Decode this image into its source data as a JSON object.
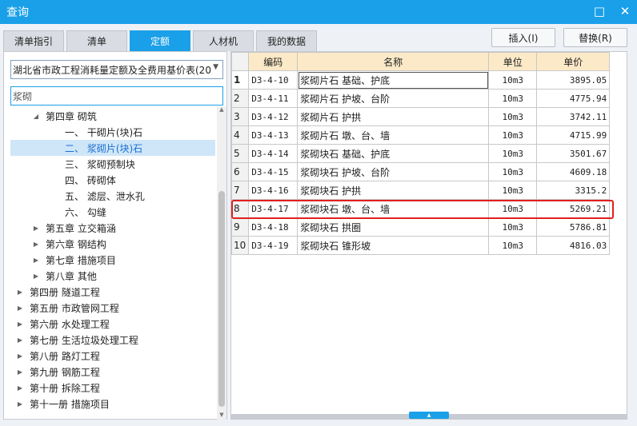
{
  "window": {
    "title": "查询",
    "minimize_glyph": "□",
    "close_glyph": "✕"
  },
  "tabs": [
    {
      "label": "清单指引"
    },
    {
      "label": "清单"
    },
    {
      "label": "定额"
    },
    {
      "label": "人材机"
    },
    {
      "label": "我的数据"
    }
  ],
  "active_tab": "定额",
  "buttons": {
    "insert": "插入(I)",
    "replace": "替换(R)"
  },
  "library": {
    "selected": "湖北省市政工程消耗量定额及全费用基价表(20"
  },
  "search": {
    "value": "浆砌"
  },
  "tree": [
    {
      "label": "第四章 砌筑",
      "level": 1,
      "expanded": true
    },
    {
      "label": "一、 干砌片(块)石",
      "level": 2
    },
    {
      "label": "二、 浆砌片(块)石",
      "level": 2,
      "selected": true
    },
    {
      "label": "三、 浆砌预制块",
      "level": 2
    },
    {
      "label": "四、 砖砌体",
      "level": 2
    },
    {
      "label": "五、 滤层、泄水孔",
      "level": 2
    },
    {
      "label": "六、 勾缝",
      "level": 2
    },
    {
      "label": "第五章 立交箱涵",
      "level": 1
    },
    {
      "label": "第六章 钢结构",
      "level": 1
    },
    {
      "label": "第七章 措施项目",
      "level": 1
    },
    {
      "label": "第八章 其他",
      "level": 1
    },
    {
      "label": "第四册 隧道工程",
      "level": 0
    },
    {
      "label": "第五册 市政管网工程",
      "level": 0
    },
    {
      "label": "第六册 水处理工程",
      "level": 0
    },
    {
      "label": "第七册 生活垃圾处理工程",
      "level": 0
    },
    {
      "label": "第八册 路灯工程",
      "level": 0
    },
    {
      "label": "第九册 钢筋工程",
      "level": 0
    },
    {
      "label": "第十册 拆除工程",
      "level": 0
    },
    {
      "label": "第十一册 措施项目",
      "level": 0
    }
  ],
  "table": {
    "headers": {
      "code": "编码",
      "name": "名称",
      "unit": "单位",
      "price": "单价"
    },
    "rows": [
      {
        "idx": "1",
        "code": "D3-4-10",
        "name": "浆砌片石 基础、护底",
        "unit": "10m3",
        "price": "3895.05"
      },
      {
        "idx": "2",
        "code": "D3-4-11",
        "name": "浆砌片石 护坡、台阶",
        "unit": "10m3",
        "price": "4775.94"
      },
      {
        "idx": "3",
        "code": "D3-4-12",
        "name": "浆砌片石 护拱",
        "unit": "10m3",
        "price": "3742.11"
      },
      {
        "idx": "4",
        "code": "D3-4-13",
        "name": "浆砌片石 墩、台、墙",
        "unit": "10m3",
        "price": "4715.99"
      },
      {
        "idx": "5",
        "code": "D3-4-14",
        "name": "浆砌块石 基础、护底",
        "unit": "10m3",
        "price": "3501.67"
      },
      {
        "idx": "6",
        "code": "D3-4-15",
        "name": "浆砌块石 护坡、台阶",
        "unit": "10m3",
        "price": "4609.18"
      },
      {
        "idx": "7",
        "code": "D3-4-16",
        "name": "浆砌块石 护拱",
        "unit": "10m3",
        "price": "3315.2"
      },
      {
        "idx": "8",
        "code": "D3-4-17",
        "name": "浆砌块石 墩、台、墙",
        "unit": "10m3",
        "price": "5269.21"
      },
      {
        "idx": "9",
        "code": "D3-4-18",
        "name": "浆砌块石 拱圈",
        "unit": "10m3",
        "price": "5786.81"
      },
      {
        "idx": "10",
        "code": "D3-4-19",
        "name": "浆砌块石 锥形坡",
        "unit": "10m3",
        "price": "4816.03"
      }
    ],
    "highlighted_row": 8
  },
  "colors": {
    "accent": "#1aa0e8",
    "header_bg": "#fbe9c7",
    "highlight": "#e02020"
  }
}
